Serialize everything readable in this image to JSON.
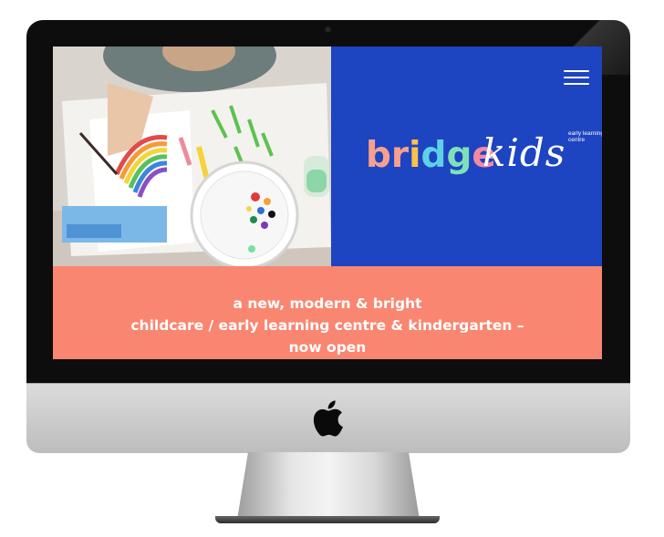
{
  "site": {
    "brand": {
      "letters": [
        {
          "char": "b",
          "color": "#f8a08e"
        },
        {
          "char": "r",
          "color": "#f8a08e"
        },
        {
          "char": "i",
          "color": "#f9c24a"
        },
        {
          "char": "d",
          "color": "#5fd1e6"
        },
        {
          "char": "g",
          "color": "#7fe0b9"
        },
        {
          "char": "e",
          "color": "#f48aa2"
        }
      ],
      "script": "kids",
      "subtitle": "early learning centre"
    },
    "menu_icon": "hamburger-menu-icon",
    "hero_image": "child painting rainbow with watercolours",
    "tagline": {
      "line1": "a new, modern & bright",
      "line2": "childcare / early learning centre & kindergarten –",
      "line3": "now open"
    }
  },
  "device": {
    "logo_icon": "apple-logo-icon"
  },
  "colors": {
    "brand_panel": "#1d44c1",
    "tagline_band": "#f98671",
    "text_light": "#ffffff"
  }
}
